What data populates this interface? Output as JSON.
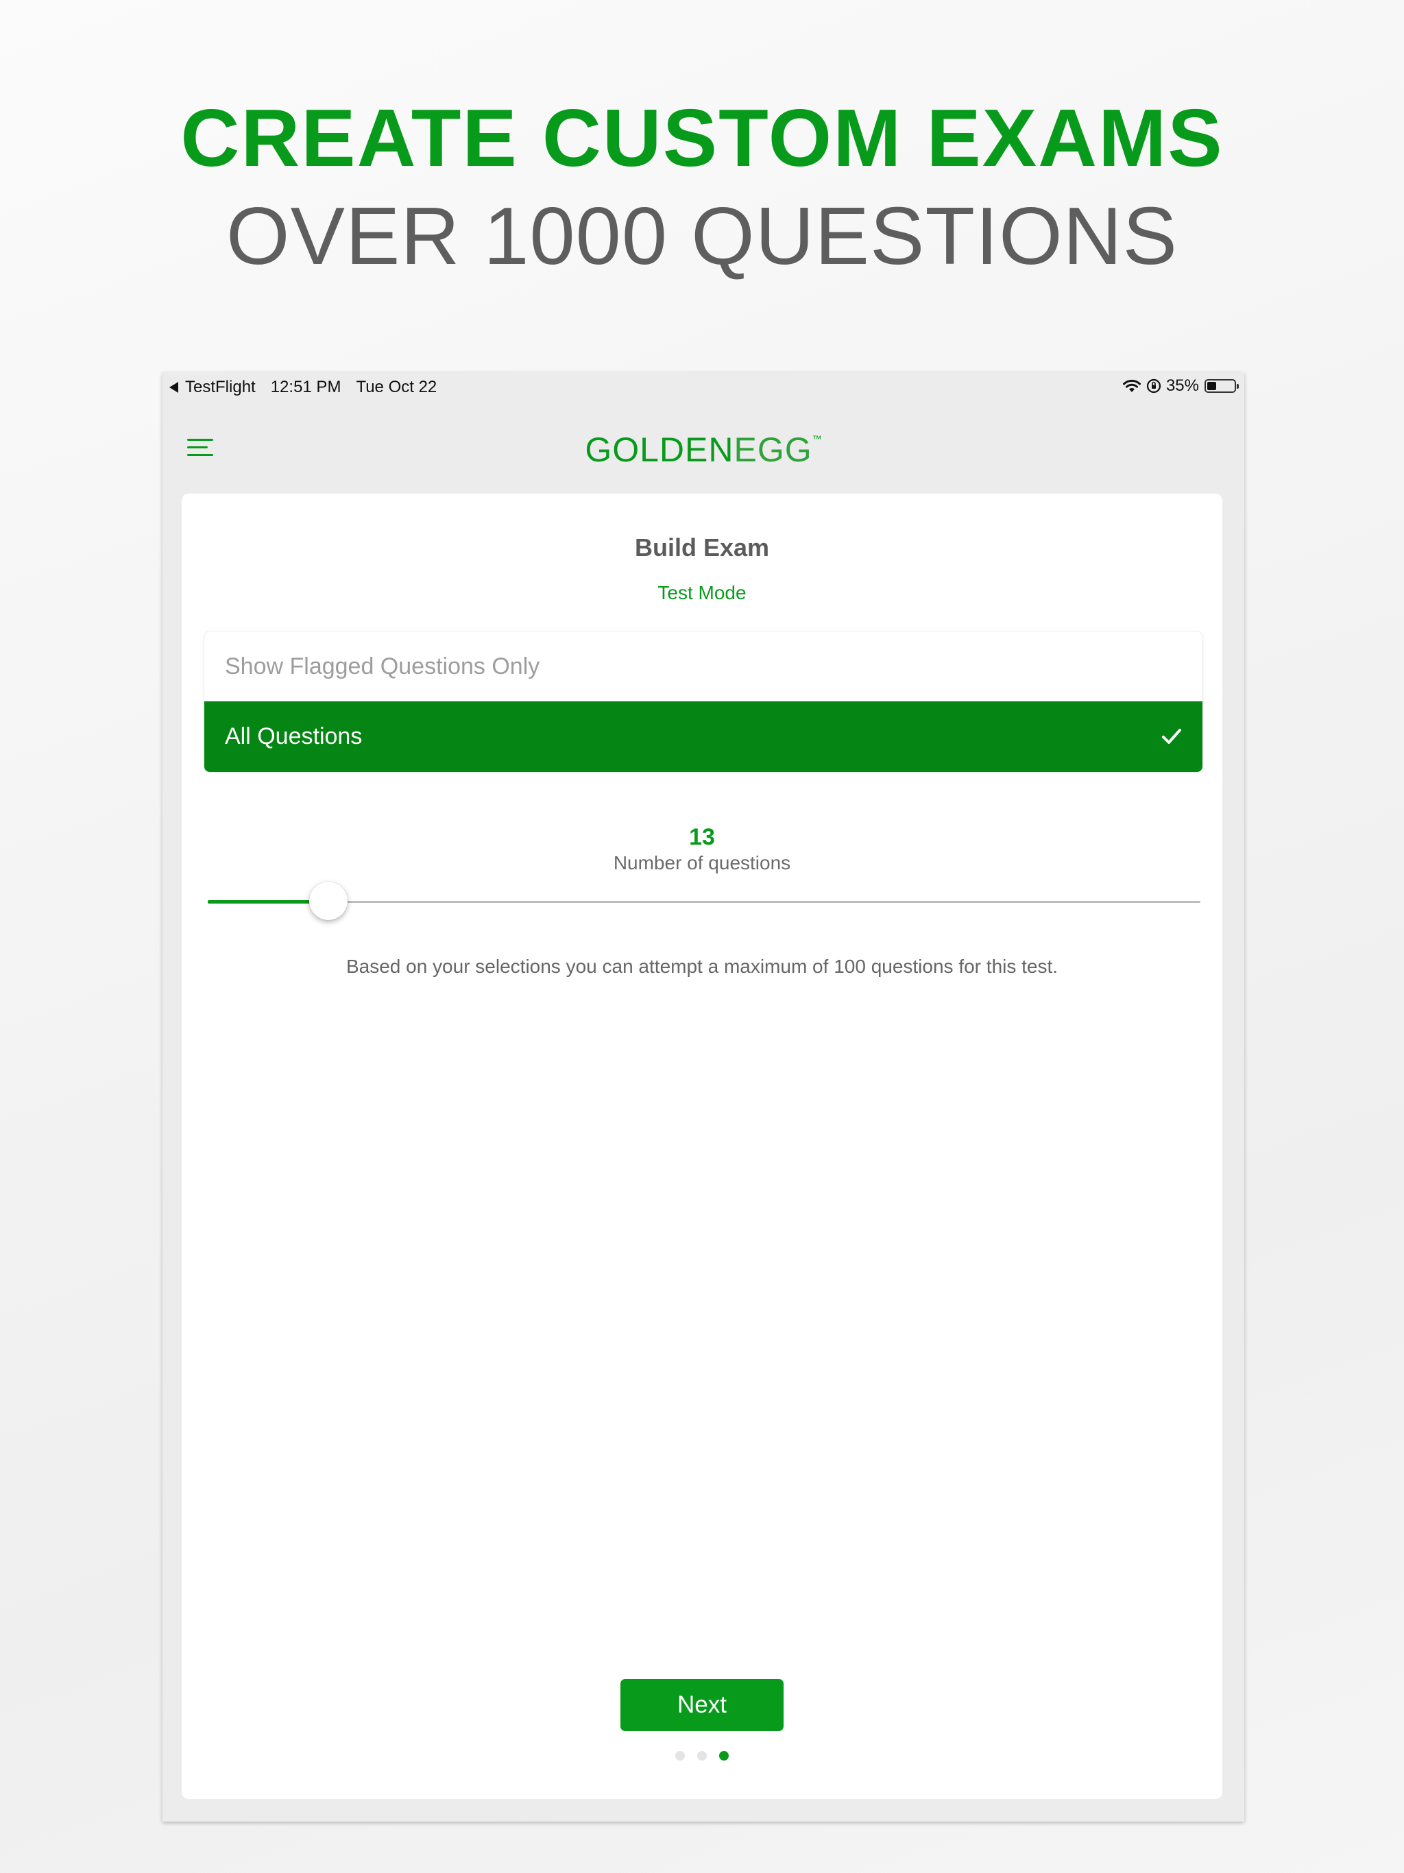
{
  "promo": {
    "headline": "CREATE CUSTOM EXAMS",
    "subheadline": "OVER 1000 QUESTIONS"
  },
  "status_bar": {
    "back_app": "TestFlight",
    "time": "12:51 PM",
    "date": "Tue Oct 22",
    "battery_percent": "35%",
    "battery_level": 0.35
  },
  "nav": {
    "logo_part1": "GOLDEN",
    "logo_part2": "EGG",
    "logo_tm": "™",
    "menu_icon": "hamburger-menu-icon"
  },
  "exam": {
    "title": "Build Exam",
    "mode": "Test Mode",
    "options": [
      {
        "label": "Show Flagged Questions Only",
        "selected": false
      },
      {
        "label": "All Questions",
        "selected": true
      }
    ],
    "question_count": "13",
    "question_count_label": "Number of questions",
    "slider": {
      "value": 13,
      "min": 1,
      "max": 100
    },
    "note": "Based on your selections you can attempt a maximum of 100 questions for this test.",
    "next_label": "Next",
    "pager": {
      "total": 3,
      "active_index": 2
    }
  },
  "colors": {
    "accent": "#089b1b",
    "selected_row": "#058513",
    "headline_gray": "#5e5e5e"
  }
}
